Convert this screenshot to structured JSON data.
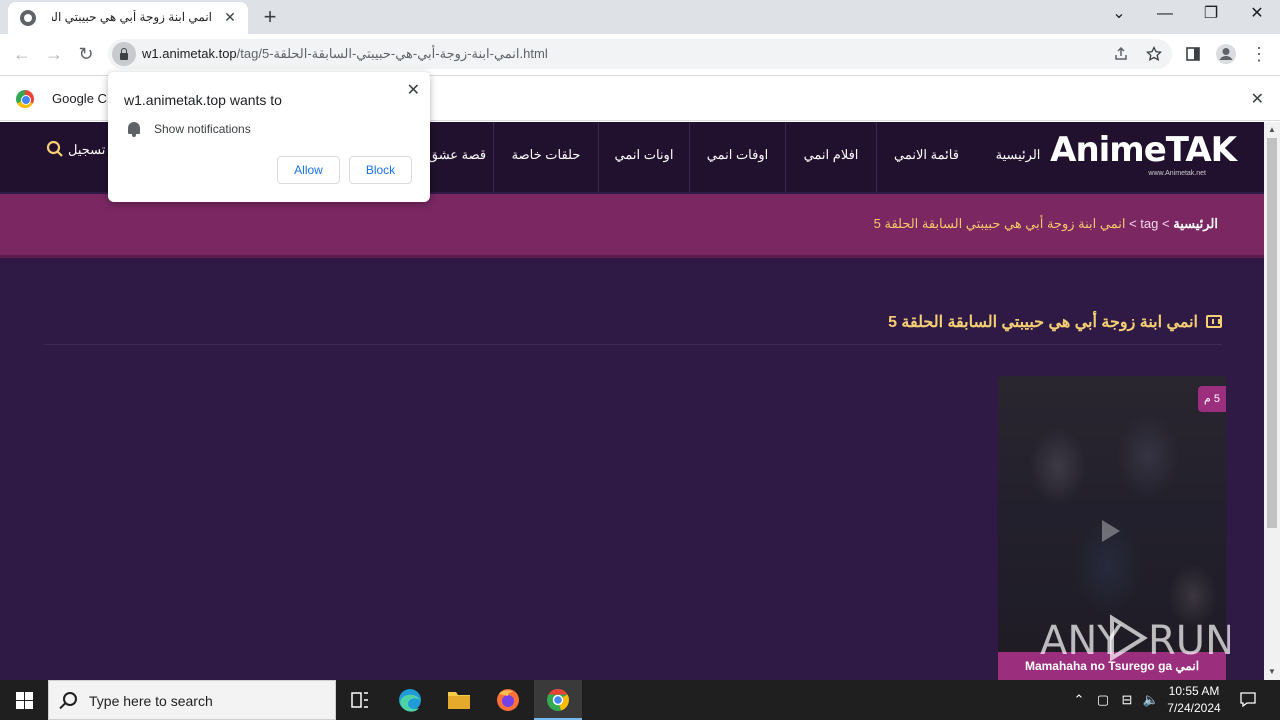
{
  "browser": {
    "tab_title": "انمي ابنة زوجة أبي هي حبيبتي السا",
    "tab_close": "✕",
    "new_tab": "+",
    "url_domain": "w1.animetak.top",
    "url_path": "/tag/5-انمي-ابنة-زوجة-أبي-هي-حبيبتي-السابقة-الحلقة.html",
    "window_controls": {
      "dropdown": "⌄",
      "minimize": "—",
      "restore": "❐",
      "close": "✕"
    },
    "nav": {
      "back": "←",
      "forward": "→",
      "reload": "↻"
    },
    "toolbar_icons": [
      "share-icon",
      "star-icon",
      "sidebar-icon",
      "profile-icon",
      "menu-icon"
    ]
  },
  "infobar": {
    "text": "Google C",
    "close": "✕"
  },
  "popup": {
    "title": "w1.animetak.top wants to",
    "permission": "Show notifications",
    "allow": "Allow",
    "block": "Block",
    "close": "✕"
  },
  "site": {
    "logo_text": "AnimeTAK",
    "logo_sub": "www.Animetak.net",
    "signin": "تسجيل",
    "nav": [
      "الرئيسية",
      "قائمة الانمي",
      "افلام انمي",
      "اوفات انمي",
      "اونات انمي",
      "حلقات خاصة",
      "قصة عشق"
    ],
    "breadcrumb": {
      "home": "الرئيسية",
      "sep1": ">",
      "tag": "tag",
      "sep2": ">",
      "current": "انمي ابنة زوجة أبي هي حبيبتي السابقة الحلقة 5"
    },
    "heading": "انمي ابنة زوجة أبي هي حبيبتي السابقة الحلقة 5",
    "card": {
      "badge": "5 م",
      "caption": "انمي Mamahaha no Tsurego ga"
    },
    "watermark": "ANY RUN"
  },
  "taskbar": {
    "search_placeholder": "Type here to search",
    "time": "10:55 AM",
    "date": "7/24/2024"
  },
  "colors": {
    "site_bg": "#2f1a45",
    "nav_bg": "#21112f",
    "crumb_bg": "#7a2762",
    "accent_gold": "#f5cf74",
    "accent_pink": "#9b2f7e"
  }
}
